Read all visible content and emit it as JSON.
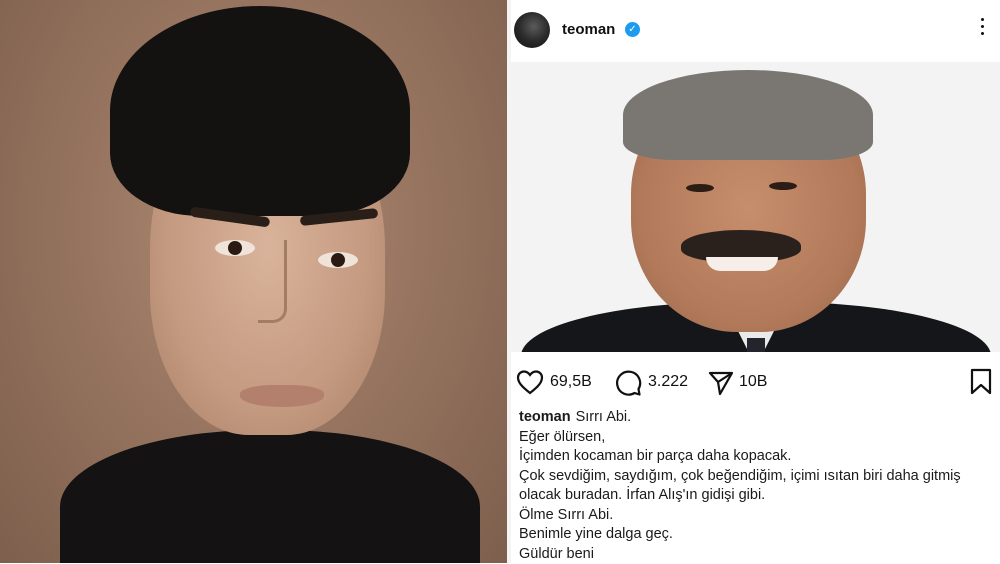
{
  "post": {
    "username": "teoman",
    "verified_mark": "✓",
    "stats": {
      "likes": "69,5B",
      "comments": "3.222",
      "shares": "10B"
    },
    "caption": {
      "author": "teoman",
      "first_line": "Sırrı Abi.",
      "lines": [
        "Eğer ölürsen,",
        "İçimden kocaman bir parça daha kopacak.",
        "Çok sevdiğim, saydığım, çok beğendiğim, içimi ısıtan biri daha gitmiş olacak buradan. İrfan Alış'ın gidişi gibi.",
        "Ölme Sırrı Abi.",
        "Benimle yine dalga geç.",
        "Güldür beni"
      ]
    }
  },
  "icons": {
    "more": "more-icon",
    "like": "heart-icon",
    "comment": "comment-icon",
    "share": "paper-plane-icon",
    "save": "bookmark-icon"
  }
}
